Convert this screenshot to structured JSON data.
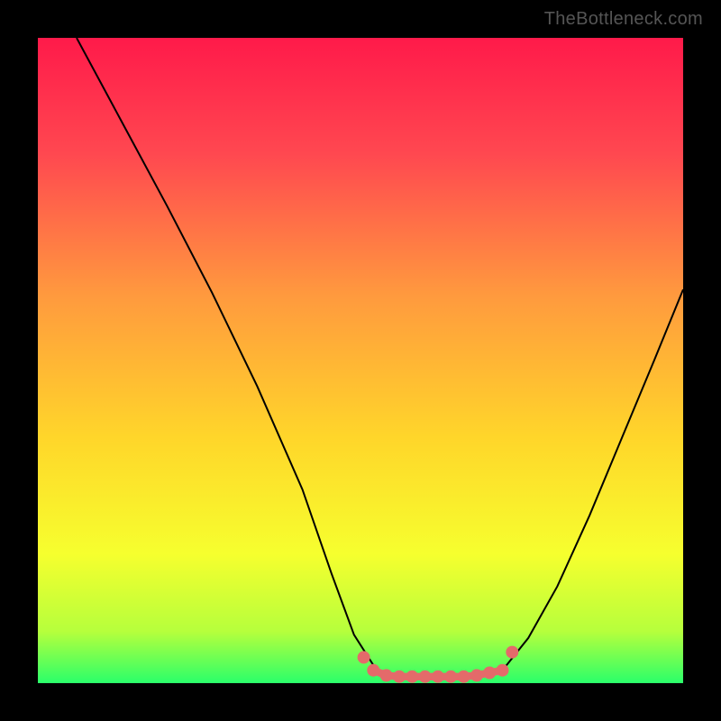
{
  "watermark": "TheBottleneck.com",
  "chart_data": {
    "type": "line",
    "title": "",
    "xlabel": "",
    "ylabel": "",
    "xlim": [
      0,
      1
    ],
    "ylim": [
      0,
      1
    ],
    "gradient_stops": [
      {
        "offset": 0.0,
        "color": "#ff1a4a"
      },
      {
        "offset": 0.18,
        "color": "#ff4850"
      },
      {
        "offset": 0.4,
        "color": "#ff9a3e"
      },
      {
        "offset": 0.62,
        "color": "#ffd62a"
      },
      {
        "offset": 0.8,
        "color": "#f6ff2e"
      },
      {
        "offset": 0.92,
        "color": "#b6ff3c"
      },
      {
        "offset": 1.0,
        "color": "#2aff6a"
      }
    ],
    "series": [
      {
        "name": "left-branch",
        "color": "#000000",
        "x": [
          0.06,
          0.13,
          0.2,
          0.27,
          0.34,
          0.41,
          0.455,
          0.49,
          0.525
        ],
        "y": [
          1.0,
          0.87,
          0.74,
          0.605,
          0.46,
          0.3,
          0.17,
          0.075,
          0.02
        ]
      },
      {
        "name": "right-branch",
        "color": "#000000",
        "x": [
          0.72,
          0.76,
          0.805,
          0.855,
          0.905,
          0.955,
          1.0
        ],
        "y": [
          0.02,
          0.07,
          0.15,
          0.26,
          0.38,
          0.5,
          0.61
        ]
      }
    ],
    "flat_segment": {
      "name": "bottom-flat",
      "color": "#e46a6a",
      "stroke_width": 14,
      "linecap": "round",
      "x": [
        0.52,
        0.54,
        0.56,
        0.58,
        0.6,
        0.62,
        0.64,
        0.66,
        0.68,
        0.7,
        0.72
      ],
      "y": [
        0.02,
        0.012,
        0.01,
        0.01,
        0.01,
        0.01,
        0.01,
        0.01,
        0.012,
        0.016,
        0.02
      ]
    }
  }
}
